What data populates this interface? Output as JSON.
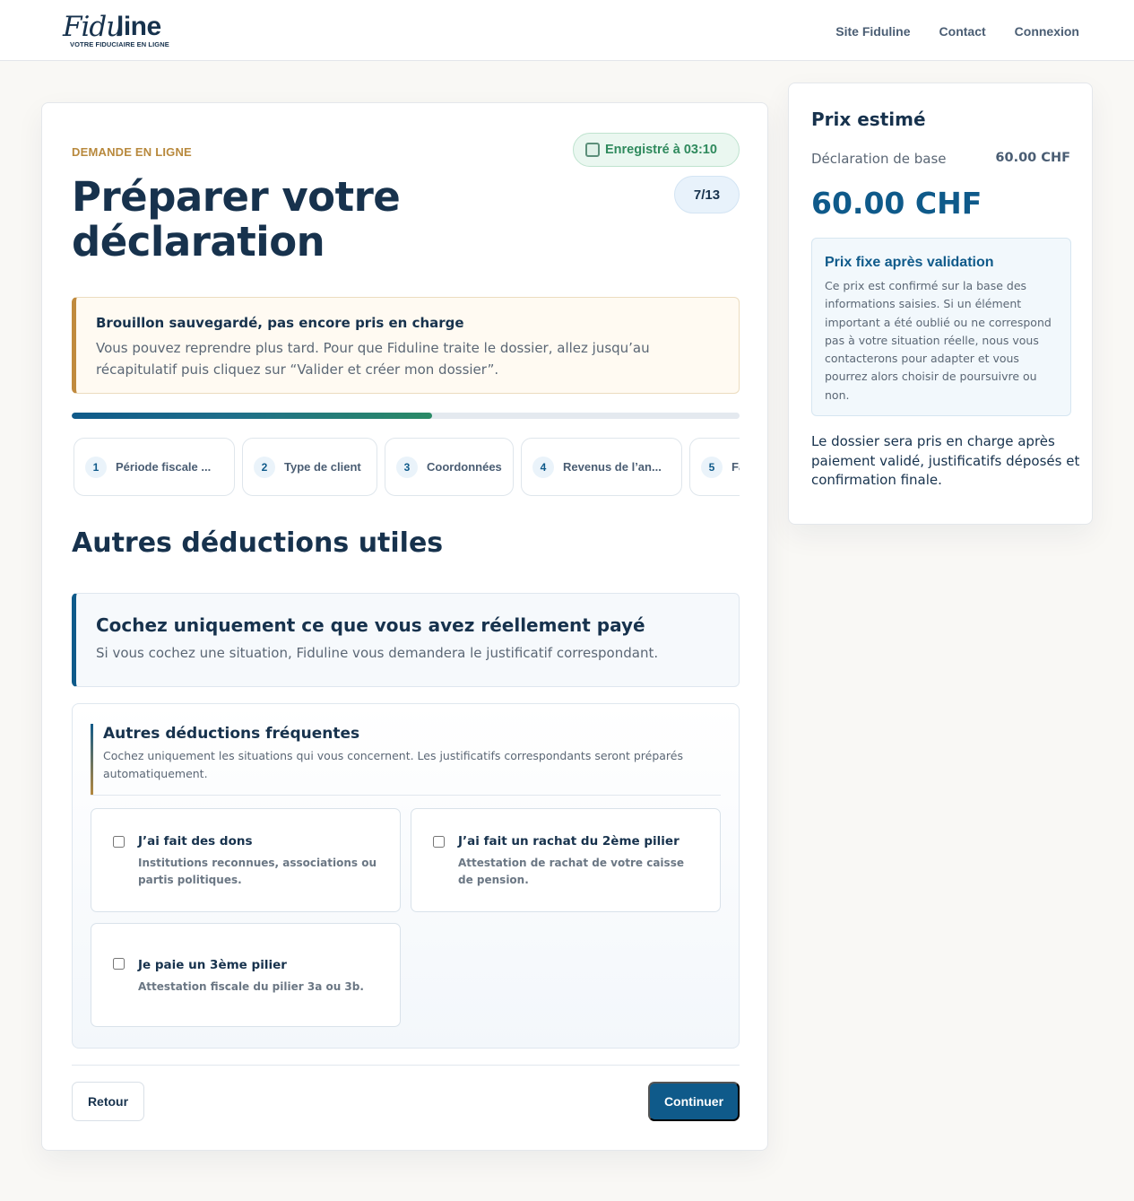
{
  "header": {
    "logo_script": "Fidu",
    "logo_bold": "line",
    "logo_tagline": "VOTRE FIDUCIAIRE EN LIGNE",
    "nav": [
      "Site Fiduline",
      "Contact",
      "Connexion"
    ]
  },
  "form": {
    "eyebrow": "DEMANDE EN LIGNE",
    "saved_status": "Enregistré à 03:10",
    "step_counter": "7/13",
    "title": "Préparer votre déclaration",
    "notice": {
      "title": "Brouillon sauvegardé, pas encore pris en charge",
      "text": "Vous pouvez reprendre plus tard. Pour que Fiduline traite le dossier, allez jusqu’au récapitulatif puis cliquez sur “Valider et créer mon dossier”."
    },
    "progress_fraction": 0.54,
    "steps": [
      {
        "num": "1",
        "label": "Période fiscale ..."
      },
      {
        "num": "2",
        "label": "Type de client"
      },
      {
        "num": "3",
        "label": "Coordonnées"
      },
      {
        "num": "4",
        "label": "Revenus de l’an..."
      },
      {
        "num": "5",
        "label": "Fa"
      }
    ],
    "section_title": "Autres déductions utiles",
    "info": {
      "title": "Cochez uniquement ce que vous avez réellement payé",
      "text": "Si vous cochez une situation, Fiduline vous demandera le justificatif correspondant."
    },
    "group": {
      "title": "Autres déductions fréquentes",
      "subtitle": "Cochez uniquement les situations qui vous concernent. Les justificatifs correspondants seront préparés automatiquement.",
      "options": [
        {
          "title": "J’ai fait des dons",
          "desc": "Institutions reconnues, associations ou partis politiques.",
          "checked": false
        },
        {
          "title": "J’ai fait un rachat du 2ème pilier",
          "desc": "Attestation de rachat de votre caisse de pension.",
          "checked": false
        },
        {
          "title": "Je paie un 3ème pilier",
          "desc": "Attestation fiscale du pilier 3a ou 3b.",
          "checked": false
        }
      ]
    },
    "back_label": "Retour",
    "next_label": "Continuer"
  },
  "price": {
    "title": "Prix estimé",
    "base_label": "Déclaration de base",
    "base_value": "60.00 CHF",
    "total": "60.00 CHF",
    "box_title": "Prix fixe après validation",
    "box_text": "Ce prix est confirmé sur la base des informations saisies. Si un élément important a été oublié ou ne correspond pas à votre situation réelle, nous vous contacterons pour adapter et vous pourrez alors choisir de poursuivre ou non.",
    "note": "Le dossier sera pris en charge après paiement validé, justificatifs déposés et confirmation finale."
  }
}
